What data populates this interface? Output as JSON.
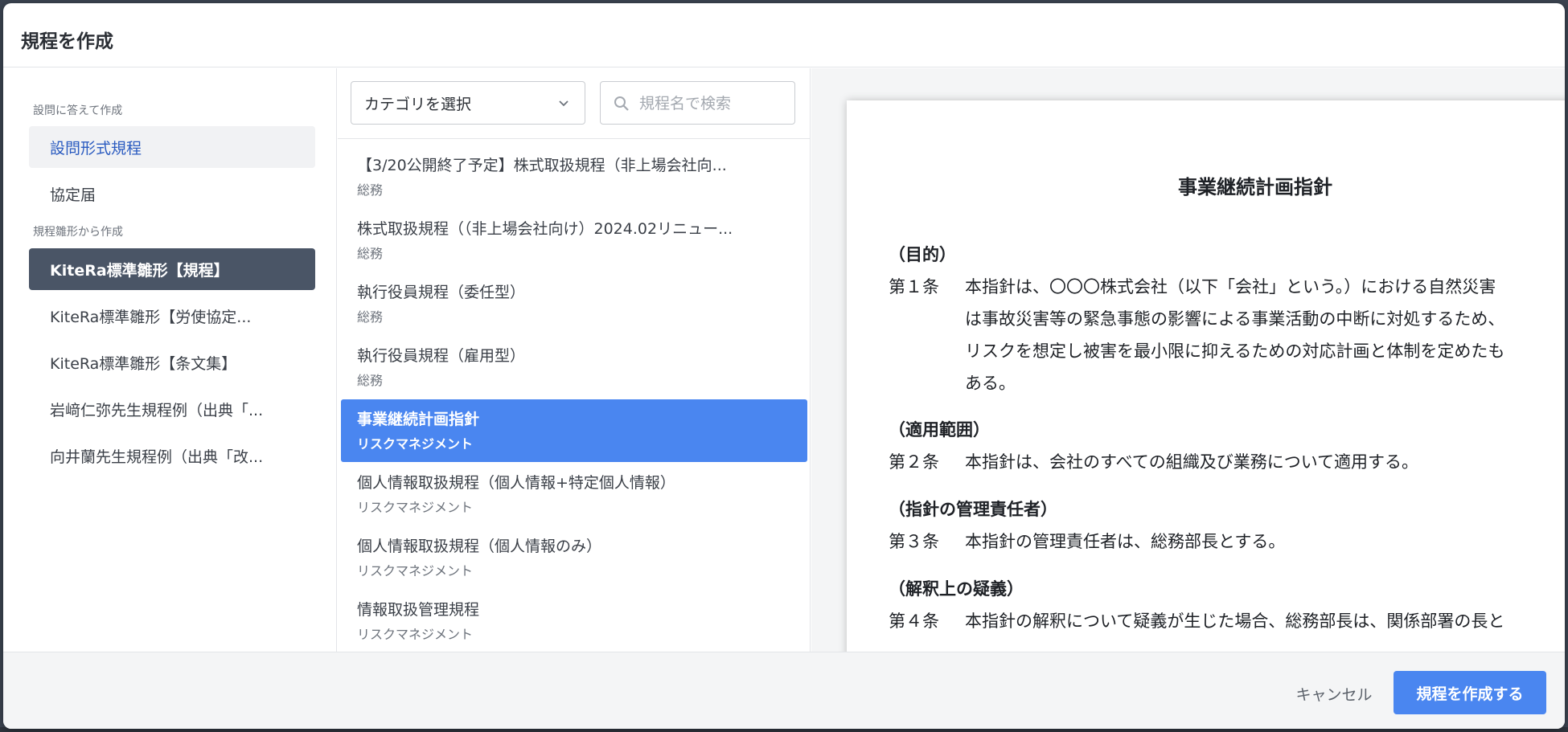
{
  "dialog": {
    "title": "規程を作成"
  },
  "sidebar": {
    "section_questions": "設問に答えて作成",
    "section_templates": "規程雛形から作成",
    "items": [
      {
        "label": "設問形式規程"
      },
      {
        "label": "協定届"
      },
      {
        "label": "KiteRa標準雛形【規程】"
      },
      {
        "label": "KiteRa標準雛形【労使協定..."
      },
      {
        "label": "KiteRa標準雛形【条文集】"
      },
      {
        "label": "岩﨑仁弥先生規程例（出典「..."
      },
      {
        "label": "向井蘭先生規程例（出典「改..."
      }
    ]
  },
  "filter": {
    "category_value": "カテゴリを選択",
    "search_placeholder": "規程名で検索"
  },
  "list": [
    {
      "title": "【3/20公開終了予定】株式取扱規程（非上場会社向...",
      "category": "総務"
    },
    {
      "title": "株式取扱規程（（非上場会社向け）2024.02リニュー...",
      "category": "総務"
    },
    {
      "title": "執行役員規程（委任型）",
      "category": "総務"
    },
    {
      "title": "執行役員規程（雇用型）",
      "category": "総務"
    },
    {
      "title": "事業継続計画指針",
      "category": "リスクマネジメント"
    },
    {
      "title": "個人情報取扱規程（個人情報+特定個人情報）",
      "category": "リスクマネジメント"
    },
    {
      "title": "個人情報取扱規程（個人情報のみ）",
      "category": "リスクマネジメント"
    },
    {
      "title": "情報取扱管理規程",
      "category": "リスクマネジメント"
    }
  ],
  "preview": {
    "title": "事業継続計画指針",
    "articles": [
      {
        "heading": "（目的）",
        "number": "第１条",
        "lines": [
          "本指針は、〇〇〇株式会社（以下「会社」という。）における自然災害",
          "は事故災害等の緊急事態の影響による事業活動の中断に対処するため、",
          "リスクを想定し被害を最小限に抑えるための対応計画と体制を定めたも",
          "ある。"
        ]
      },
      {
        "heading": "（適用範囲）",
        "number": "第２条",
        "lines": [
          "本指針は、会社のすべての組織及び業務について適用する。"
        ]
      },
      {
        "heading": "（指針の管理責任者）",
        "number": "第３条",
        "lines": [
          "本指針の管理責任者は、総務部長とする。"
        ]
      },
      {
        "heading": "（解釈上の疑義）",
        "number": "第４条",
        "lines": [
          "本指針の解釈について疑義が生じた場合、総務部長は、関係部署の長と"
        ]
      }
    ]
  },
  "footer": {
    "cancel_label": "キャンセル",
    "create_label": "規程を作成する"
  },
  "colors": {
    "accent": "#4a86f0",
    "selected_nav": "#4a5566"
  }
}
